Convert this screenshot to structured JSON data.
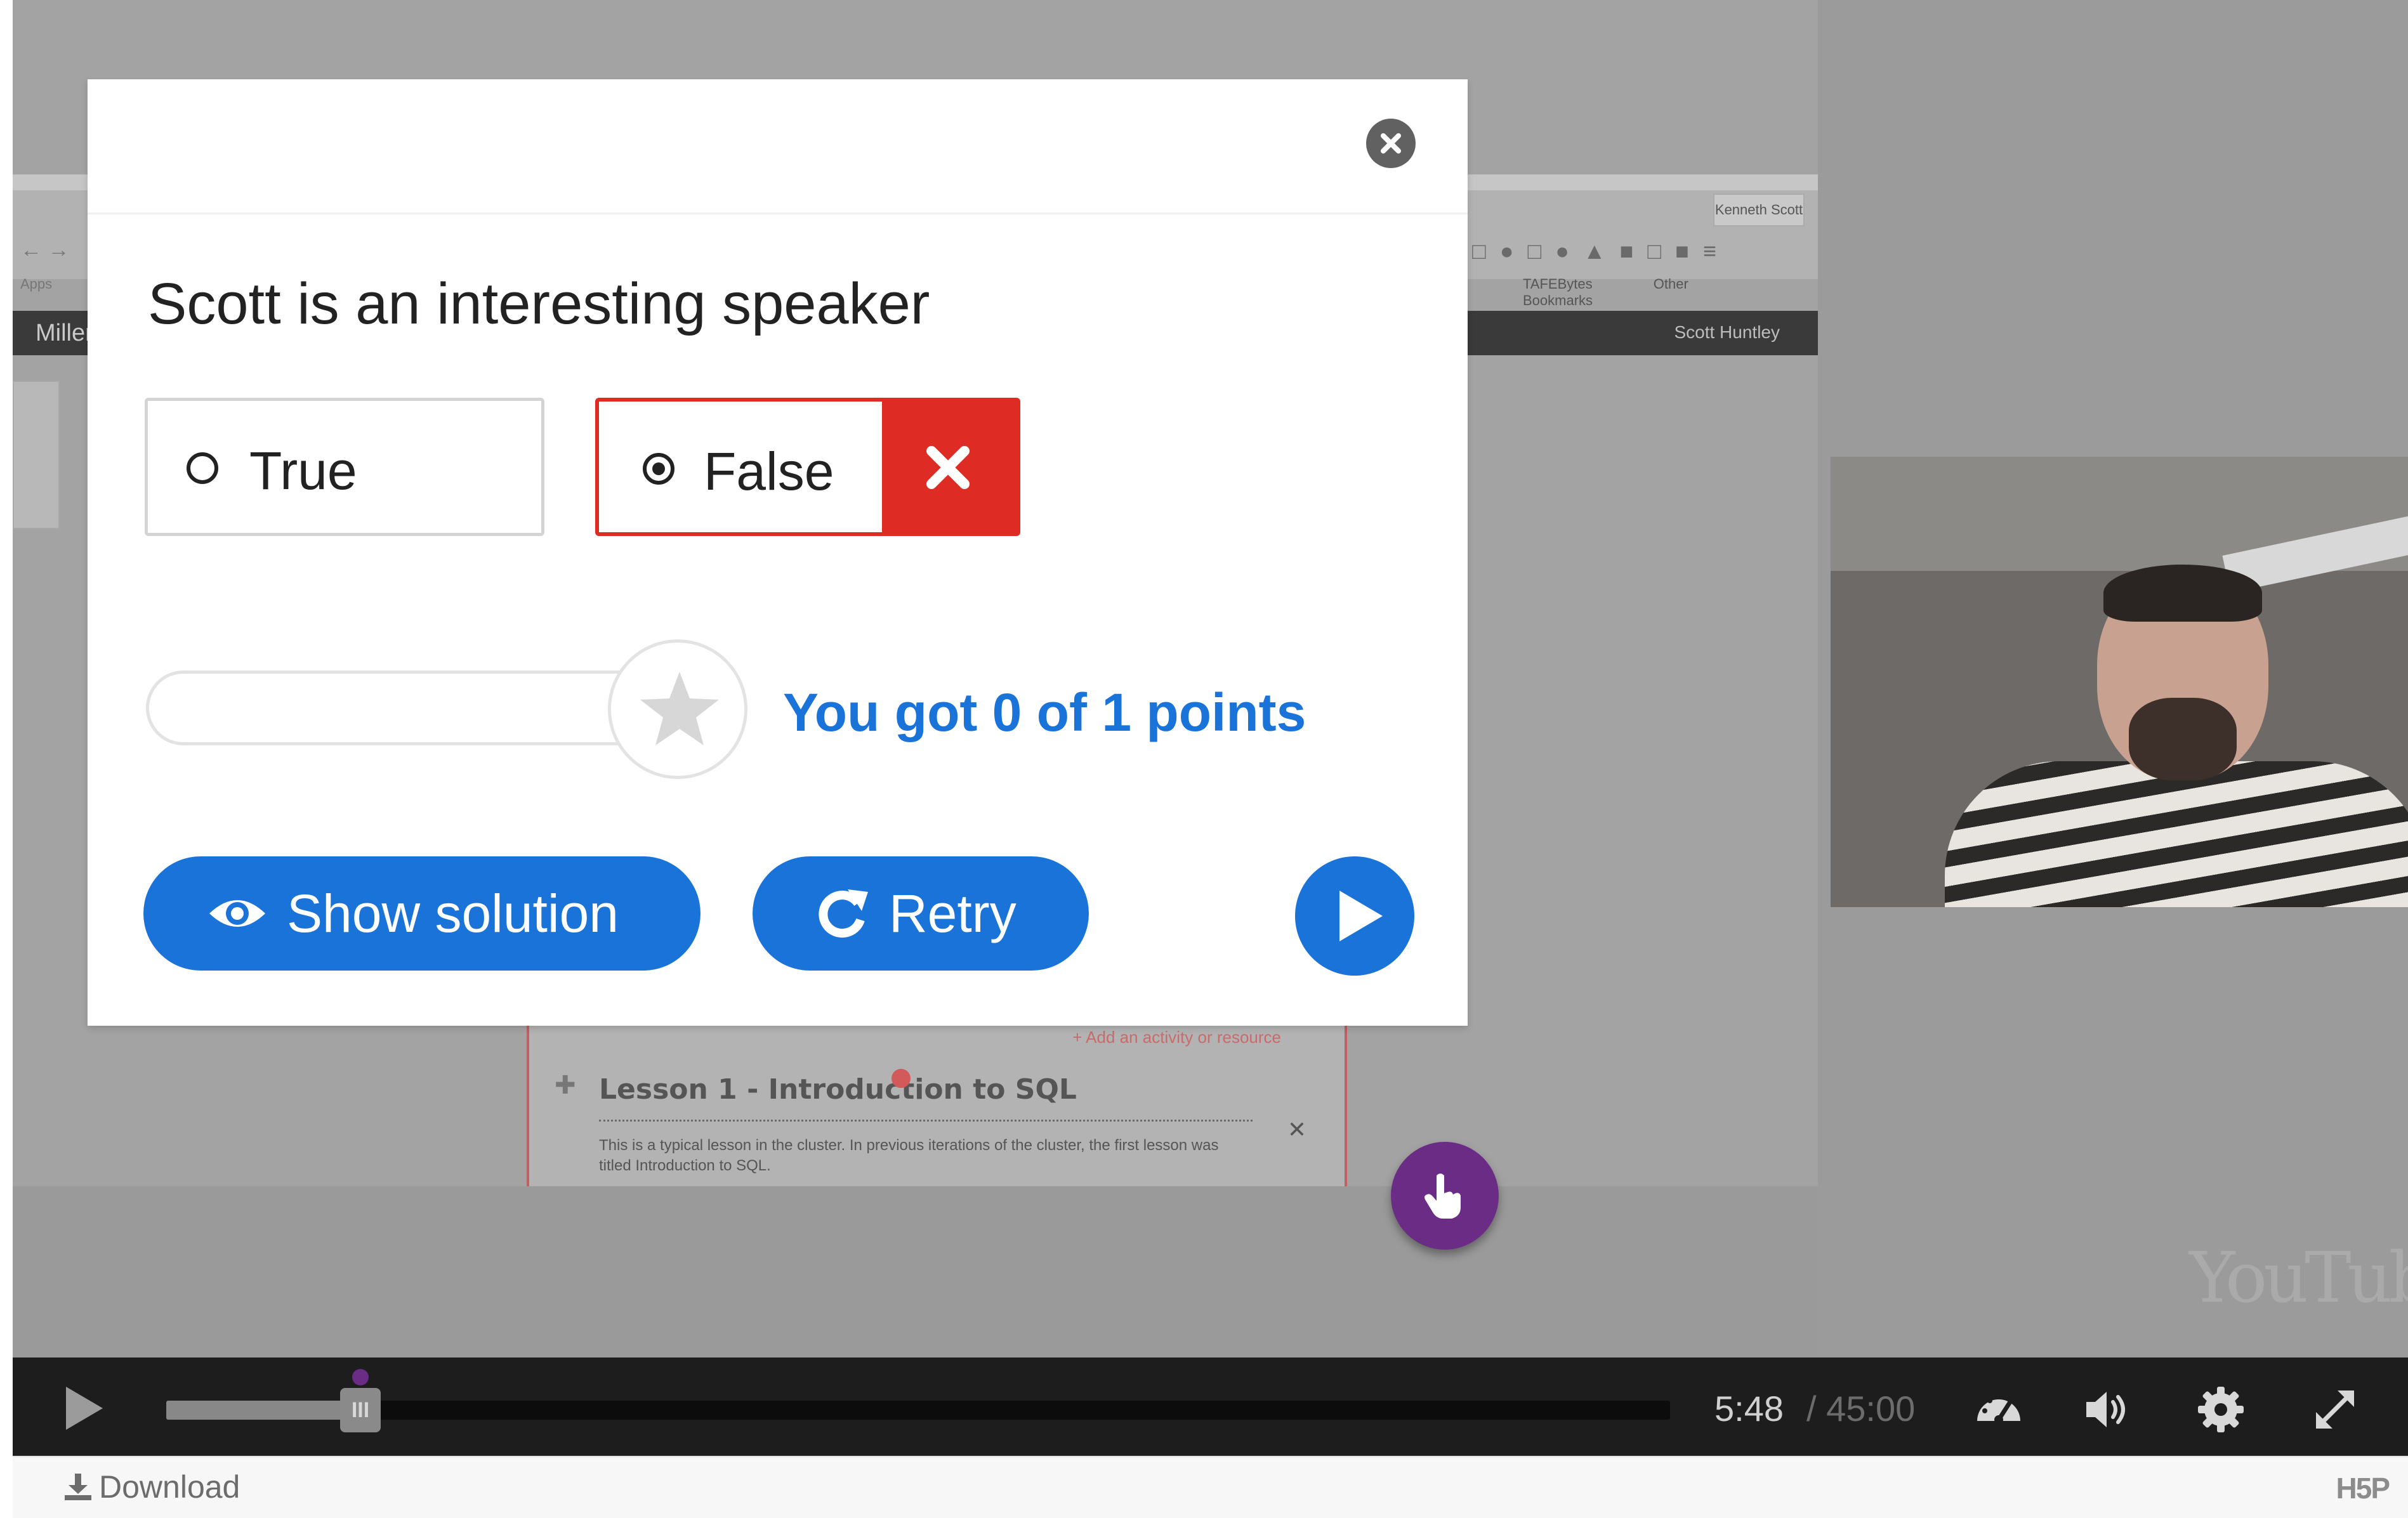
{
  "video_background": {
    "kenneth_tab": "Kenneth Scott",
    "bookmark_tafebytes": "TAFEBytes",
    "bookmark_other": "Other Bookmarks",
    "apps_label": "Apps",
    "site_name_partial": "Miller",
    "user_name": "Scott Huntley",
    "lesson_add_link": "+ Add an activity or resource",
    "lesson_title": "Lesson 1 - Introduction to SQL",
    "lesson_desc": "This is a typical lesson in the cluster. In previous iterations of the cluster, the first lesson was titled Introduction to SQL.",
    "youtube_watermark": "YouTube"
  },
  "question_dialog": {
    "question": "Scott is an interesting speaker",
    "answers": [
      {
        "label": "True",
        "selected": false
      },
      {
        "label": "False",
        "selected": true,
        "result": "wrong"
      }
    ],
    "score_text": "You got 0 of 1 points",
    "score": 0,
    "max_score": 1,
    "show_solution_label": "Show solution",
    "retry_label": "Retry"
  },
  "player": {
    "current_time": "5:48",
    "total_time": "/ 45:00",
    "progress_fraction": 0.129,
    "buffered_fraction": 0.13,
    "handle_glyph": "III"
  },
  "footer": {
    "download_label": "Download",
    "logo_text": "H5P"
  },
  "colors": {
    "accent_blue": "#1a73d9",
    "wrong_red": "#de2b24",
    "hotspot_purple": "#6a2c85",
    "control_bar": "#1d1d1d"
  },
  "icons": [
    "close-icon",
    "radio-empty-icon",
    "radio-selected-icon",
    "cross-icon",
    "star-icon",
    "eye-icon",
    "retry-icon",
    "play-icon",
    "hand-pointer-icon",
    "speedometer-icon",
    "volume-icon",
    "gear-icon",
    "fullscreen-icon",
    "download-icon"
  ]
}
